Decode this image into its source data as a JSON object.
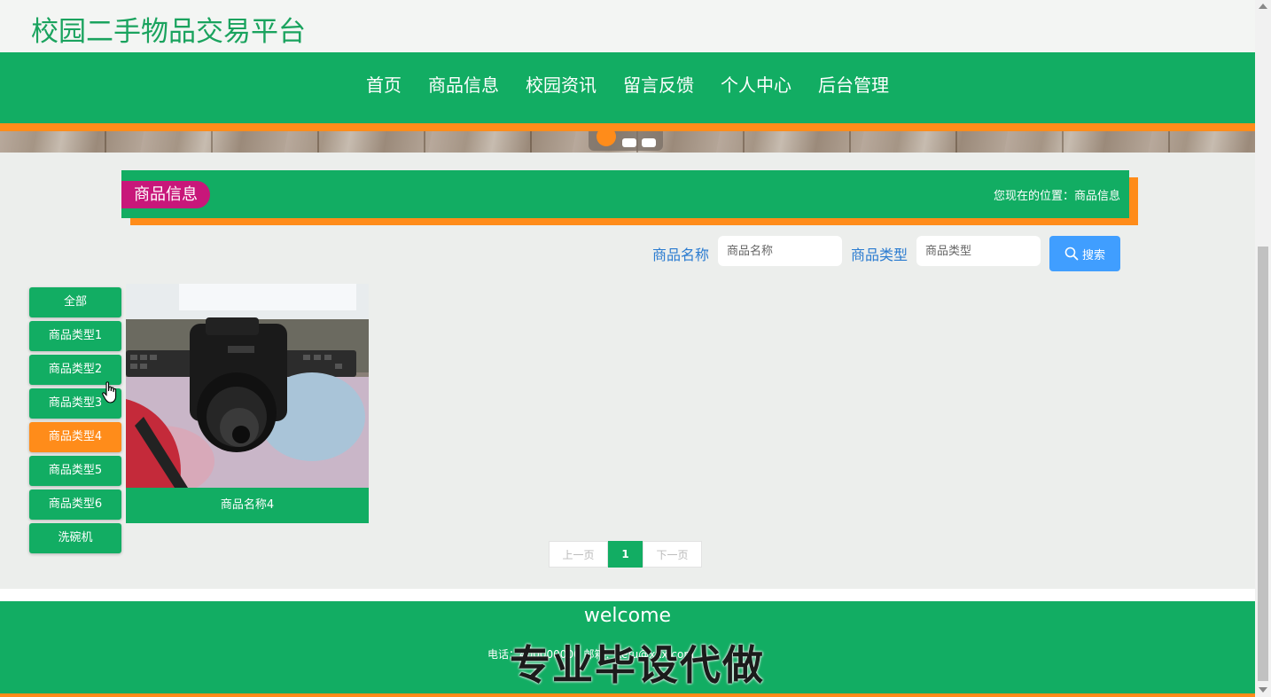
{
  "header": {
    "site_title": "校园二手物品交易平台"
  },
  "nav": {
    "items": [
      "首页",
      "商品信息",
      "校园资讯",
      "留言反馈",
      "个人中心",
      "后台管理"
    ]
  },
  "section": {
    "title": "商品信息",
    "breadcrumb": "您现在的位置：商品信息"
  },
  "search": {
    "name_label": "商品名称",
    "name_placeholder": "商品名称",
    "type_label": "商品类型",
    "type_placeholder": "商品类型",
    "button_label": "搜索"
  },
  "categories": {
    "items": [
      "全部",
      "商品类型1",
      "商品类型2",
      "商品类型3",
      "商品类型4",
      "商品类型5",
      "商品类型6",
      "洗碗机"
    ],
    "active": "商品类型4"
  },
  "products": [
    {
      "name": "商品名称4"
    }
  ],
  "pagination": {
    "prev": "上一页",
    "current": "1",
    "next": "下一页"
  },
  "footer": {
    "welcome": "welcome",
    "contact": "电话：400000000 邮箱：kefu@xxx.com",
    "watermark": "专业毕设代做"
  },
  "colors": {
    "primary": "#12ad63",
    "accent": "#ff8c1a",
    "pill": "#c8177a",
    "search_button": "#409eff"
  }
}
